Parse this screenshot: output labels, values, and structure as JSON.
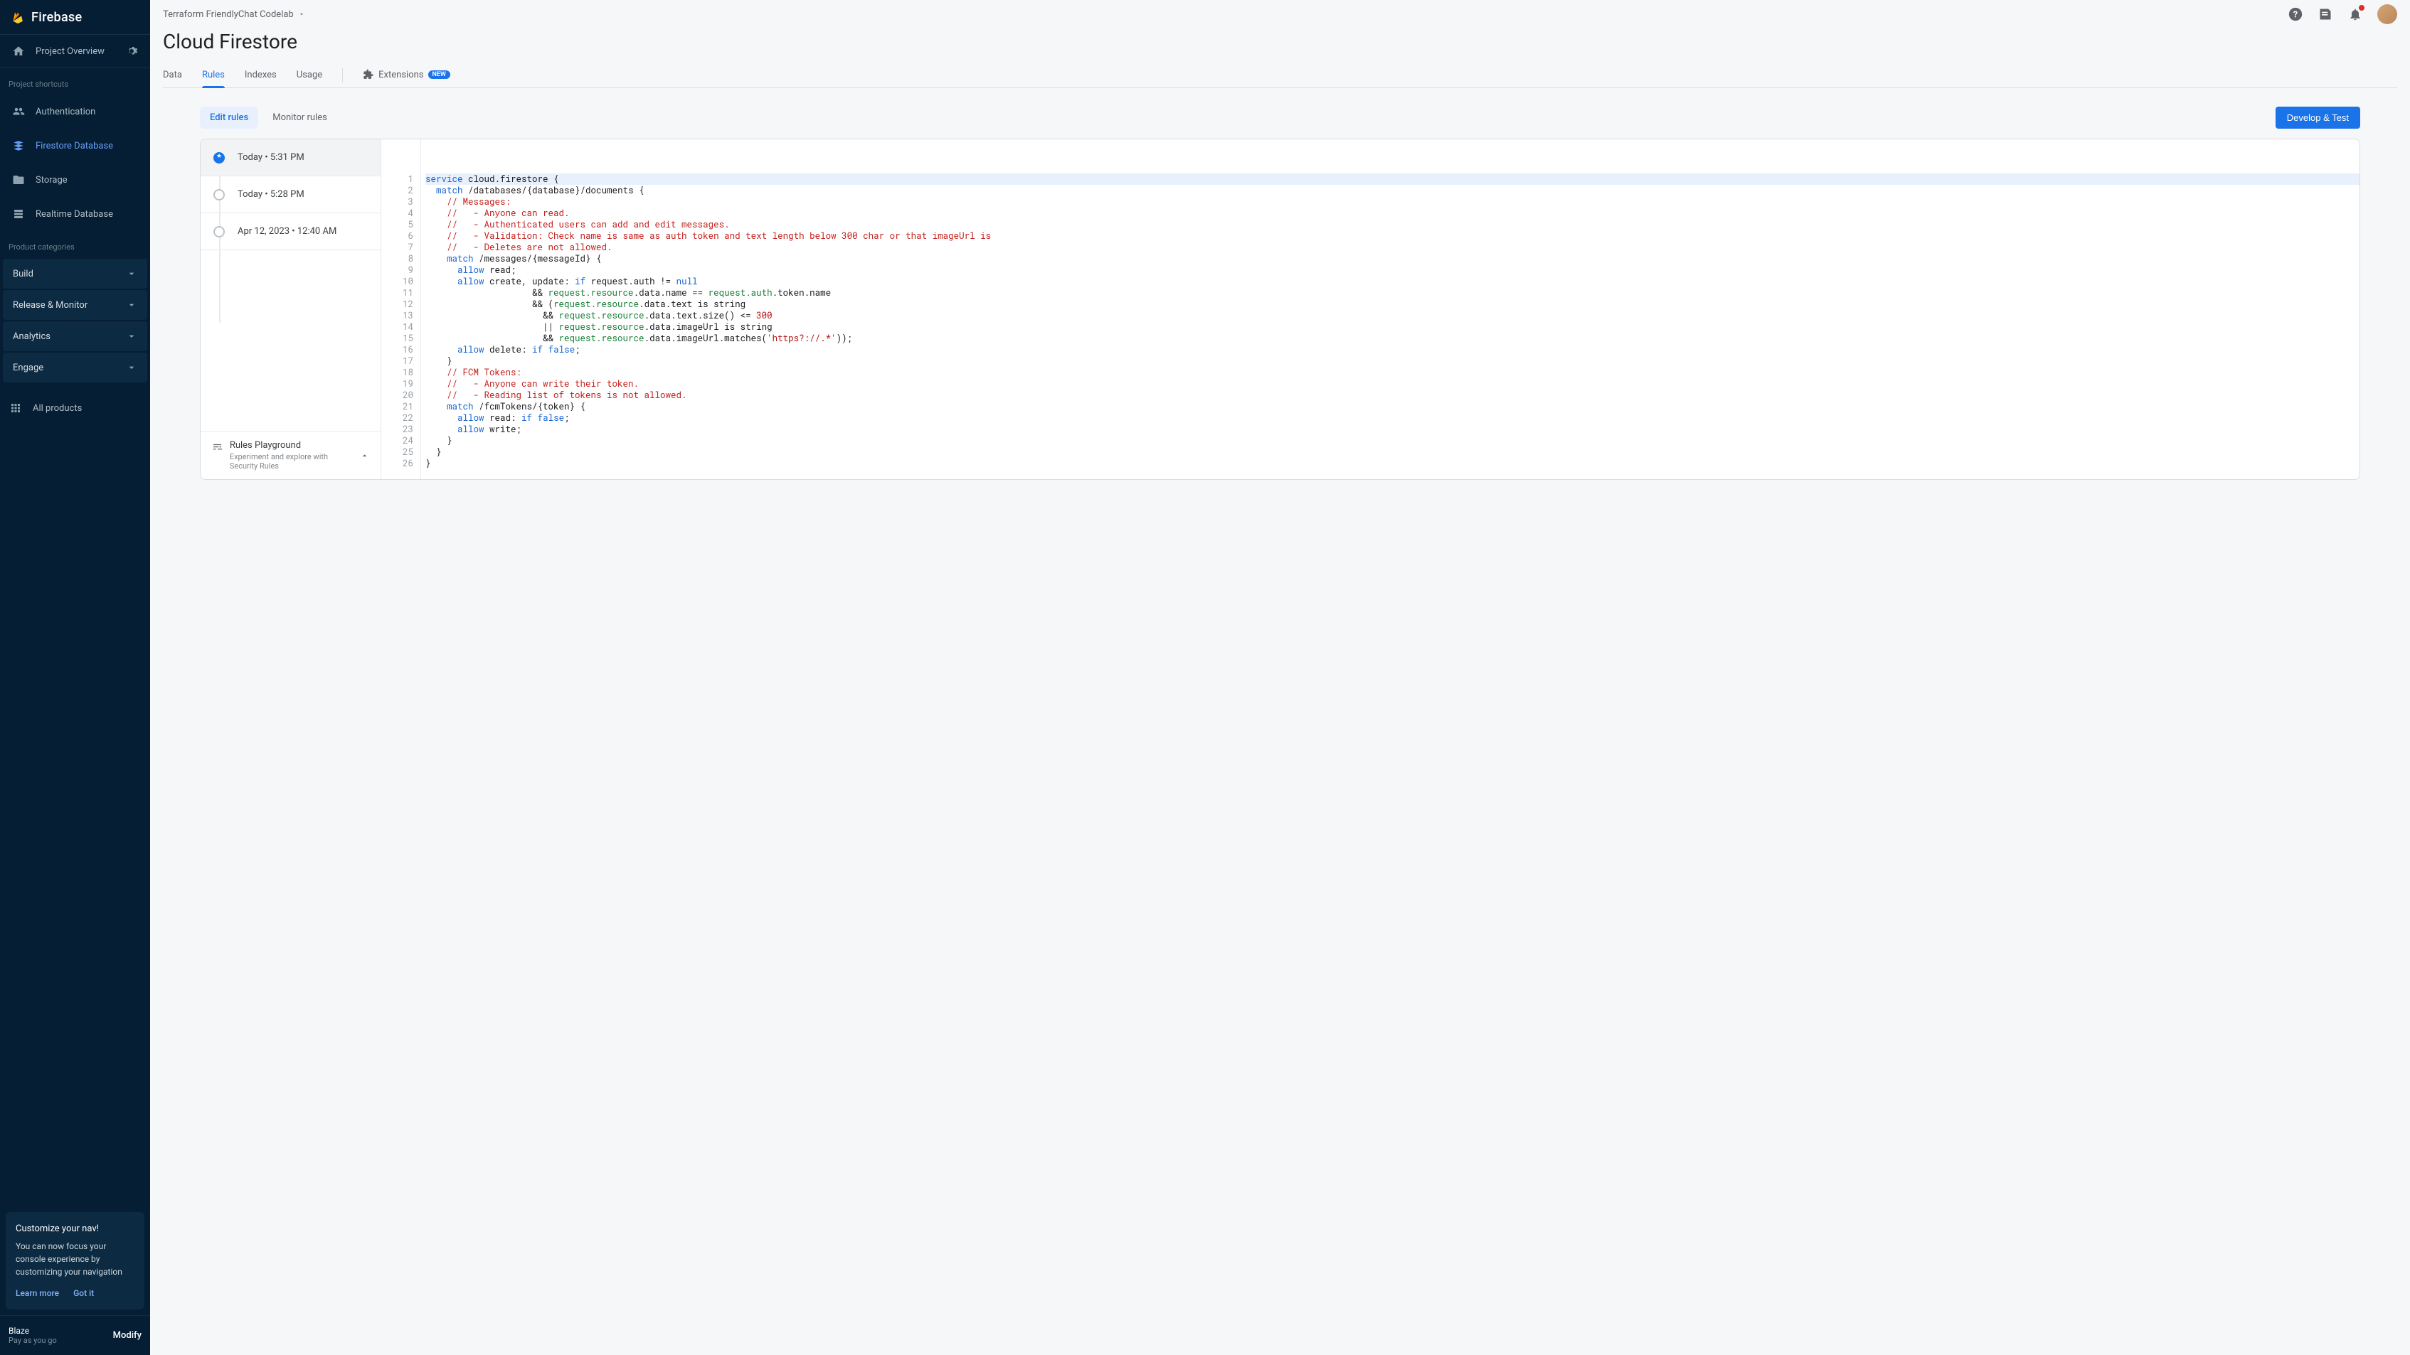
{
  "brand": "Firebase",
  "project_selector": "Terraform FriendlyChat Codelab",
  "topbar_icons": [
    "help-icon",
    "release-notes-icon",
    "notifications-icon"
  ],
  "sidebar": {
    "overview": "Project Overview",
    "shortcuts_label": "Project shortcuts",
    "shortcuts": [
      {
        "label": "Authentication",
        "icon": "users-icon"
      },
      {
        "label": "Firestore Database",
        "icon": "firestore-icon",
        "active": true
      },
      {
        "label": "Storage",
        "icon": "folder-icon"
      },
      {
        "label": "Realtime Database",
        "icon": "database-icon"
      }
    ],
    "categories_label": "Product categories",
    "categories": [
      "Build",
      "Release & Monitor",
      "Analytics",
      "Engage"
    ],
    "all_products": "All products"
  },
  "promo": {
    "title": "Customize your nav!",
    "body": "You can now focus your console experience by customizing your navigation",
    "learn": "Learn more",
    "got": "Got it"
  },
  "plan": {
    "name": "Blaze",
    "sub": "Pay as you go",
    "modify": "Modify"
  },
  "page_title": "Cloud Firestore",
  "tabs": [
    "Data",
    "Rules",
    "Indexes",
    "Usage"
  ],
  "tabs_active": "Rules",
  "extensions_label": "Extensions",
  "extensions_badge": "NEW",
  "rules_toolbar": {
    "edit": "Edit rules",
    "monitor": "Monitor rules",
    "develop": "Develop & Test"
  },
  "history": [
    {
      "label": "Today • 5:31 PM",
      "active": true
    },
    {
      "label": "Today • 5:28 PM"
    },
    {
      "label": "Apr 12, 2023 • 12:40 AM"
    }
  ],
  "playground": {
    "title": "Rules Playground",
    "sub": "Experiment and explore with Security Rules"
  },
  "code_lines": 26,
  "code": {
    "l1": {
      "t": "service",
      "r": " cloud.firestore {"
    },
    "l2": {
      "i": "  ",
      "t": "match",
      "r": " /databases/{database}/documents {"
    },
    "l3": "    // Messages:",
    "l4": "    //   - Anyone can read.",
    "l5": "    //   - Authenticated users can add and edit messages.",
    "l6": "    //   - Validation: Check name is same as auth token and text length below 300 char or that imageUrl is",
    "l7": "    //   - Deletes are not allowed.",
    "l8": {
      "i": "    ",
      "t": "match",
      "r": " /messages/{messageId} {"
    },
    "l9": {
      "i": "      ",
      "t": "allow",
      "r": " read;"
    },
    "l10_a": "allow",
    "l10_b": " create, update: ",
    "l10_c": "if",
    "l10_d": " request.auth != ",
    "l10_e": "null",
    "l11_a": "                    && ",
    "l11_b": "request.resource",
    "l11_c": ".data.name == ",
    "l11_d": "request.auth",
    "l11_e": ".token.name",
    "l12_a": "                    && (",
    "l12_b": "request.resource",
    "l12_c": ".data.text is string",
    "l13_a": "                      && ",
    "l13_b": "request.resource",
    "l13_c": ".data.text.size() <= ",
    "l13_d": "300",
    "l14_a": "                      || ",
    "l14_b": "request.resource",
    "l14_c": ".data.imageUrl is string",
    "l15_a": "                      && ",
    "l15_b": "request.resource",
    "l15_c": ".data.imageUrl.matches(",
    "l15_d": "'https?://.*'",
    "l15_e": "));",
    "l16": {
      "i": "      ",
      "t": "allow",
      "r": " delete: ",
      "c": "if",
      "v": " false",
      ";": ";"
    },
    "l17": "    }",
    "l18": "    // FCM Tokens:",
    "l19": "    //   - Anyone can write their token.",
    "l20": "    //   - Reading list of tokens is not allowed.",
    "l21": {
      "i": "    ",
      "t": "match",
      "r": " /fcmTokens/{token} {"
    },
    "l22": {
      "i": "      ",
      "t": "allow",
      "r": " read: ",
      "c": "if",
      "v": " false",
      ";": ";"
    },
    "l23": {
      "i": "      ",
      "t": "allow",
      "r": " write;"
    },
    "l24": "    }",
    "l25": "  }",
    "l26": "}"
  }
}
